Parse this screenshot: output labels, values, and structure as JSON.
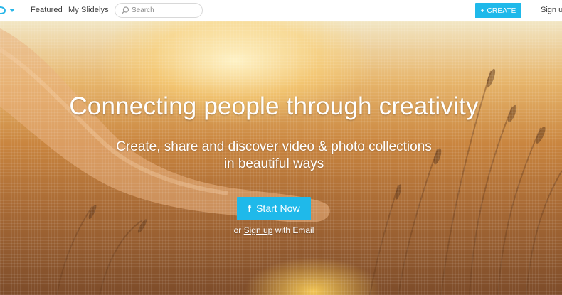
{
  "nav": {
    "featured": "Featured",
    "my_slidelys": "My Slidelys",
    "search_placeholder": "Search",
    "create_label": "+ CREATE",
    "signup_label": "Sign up"
  },
  "hero": {
    "title": "Connecting people through creativity",
    "subtitle_line1": "Create, share and discover video & photo collections",
    "subtitle_line2": "in beautiful ways",
    "start_label": "Start Now",
    "fb_icon": "f",
    "alt_prefix": "or",
    "alt_link": "Sign up",
    "alt_suffix": "with Email"
  },
  "colors": {
    "accent": "#1fb9ea",
    "nav_text": "#3a3a3a"
  },
  "icons": [
    "slidely-logo-icon",
    "caret-down-icon",
    "search-icon",
    "facebook-icon"
  ]
}
